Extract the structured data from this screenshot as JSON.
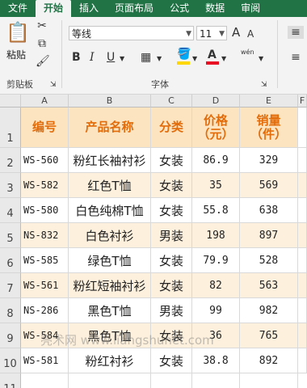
{
  "tabs": [
    {
      "label": "文件",
      "active": false
    },
    {
      "label": "开始",
      "active": true
    },
    {
      "label": "插入",
      "active": false
    },
    {
      "label": "页面布局",
      "active": false
    },
    {
      "label": "公式",
      "active": false
    },
    {
      "label": "数据",
      "active": false
    },
    {
      "label": "审阅",
      "active": false
    }
  ],
  "ribbon": {
    "paste_label": "粘贴",
    "clipboard_label": "剪贴板",
    "font_group_label": "字体",
    "font_name": "等线",
    "font_size": "11",
    "bold": "B",
    "italic": "I",
    "underline": "U",
    "grow_font": "A",
    "shrink_font": "A",
    "font_color_letter": "A",
    "phonetic": "wén",
    "font_color": "#e81123",
    "fill_color": "#ffd700"
  },
  "columns": [
    "A",
    "B",
    "C",
    "D",
    "E",
    "F"
  ],
  "rows": [
    "1",
    "2",
    "3",
    "4",
    "5",
    "6",
    "7",
    "8",
    "9",
    "10",
    "11"
  ],
  "headers": {
    "code": "编号",
    "name": "产品名称",
    "category": "分类",
    "price": [
      "价格",
      "（元）"
    ],
    "sales": [
      "销量",
      "（件）"
    ]
  },
  "records": [
    {
      "code": "WS-560",
      "name": "粉红长袖衬衫",
      "category": "女装",
      "price": "86.9",
      "sales": "329"
    },
    {
      "code": "WS-582",
      "name": "红色T恤",
      "category": "女装",
      "price": "35",
      "sales": "569"
    },
    {
      "code": "WS-580",
      "name": "白色纯棉T恤",
      "category": "女装",
      "price": "55.8",
      "sales": "638"
    },
    {
      "code": "NS-832",
      "name": "白色衬衫",
      "category": "男装",
      "price": "198",
      "sales": "897"
    },
    {
      "code": "WS-585",
      "name": "绿色T恤",
      "category": "女装",
      "price": "79.9",
      "sales": "528"
    },
    {
      "code": "WS-561",
      "name": "粉红短袖衬衫",
      "category": "女装",
      "price": "82",
      "sales": "563"
    },
    {
      "code": "NS-286",
      "name": "黑色T恤",
      "category": "男装",
      "price": "99",
      "sales": "982"
    },
    {
      "code": "WS-584",
      "name": "黑色T恤",
      "category": "女装",
      "price": "36",
      "sales": "765"
    },
    {
      "code": "WS-581",
      "name": "粉红衬衫",
      "category": "女装",
      "price": "38.8",
      "sales": "892"
    }
  ],
  "watermark": "亮术网 www.liangshunet.com",
  "colors": {
    "ribbon_green": "#217346",
    "header_fill": "#fce4c0",
    "header_text": "#e36c0a",
    "band_fill": "#fdf0dc"
  }
}
